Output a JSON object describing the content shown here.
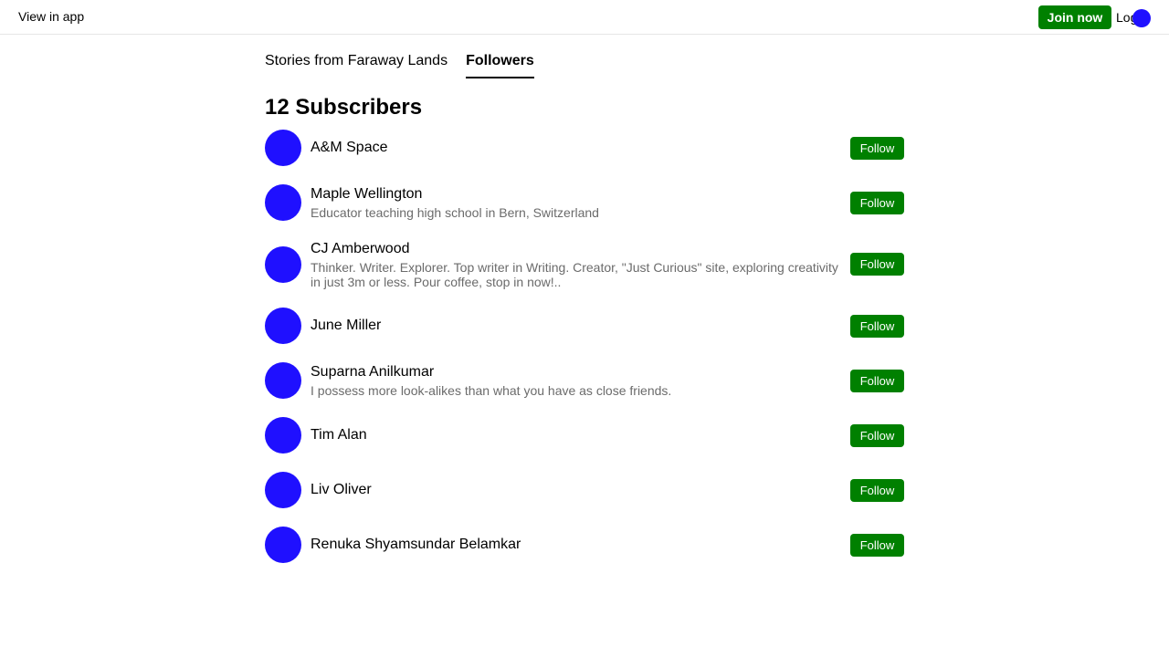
{
  "topbar": {
    "view_in_app": "View in app",
    "join_now": "Join now",
    "login": "Log"
  },
  "tabs": [
    {
      "label": "Stories from Faraway Lands",
      "active": false
    },
    {
      "label": "Followers",
      "active": true
    }
  ],
  "subscribers_title": "12 Subscribers",
  "follow_label": "Follow",
  "subscribers": [
    {
      "name": "A&M Space",
      "bio": ""
    },
    {
      "name": "Maple Wellington",
      "bio": "Educator teaching high school in Bern, Switzerland"
    },
    {
      "name": "CJ Amberwood",
      "bio": "Thinker. Writer. Explorer. Top writer in Writing. Creator, \"Just Curious\" site, exploring creativity in just 3m or less. Pour coffee, stop in now!.."
    },
    {
      "name": "June Miller",
      "bio": ""
    },
    {
      "name": "Suparna Anilkumar",
      "bio": "I possess more look-alikes than what you have as close friends."
    },
    {
      "name": "Tim Alan",
      "bio": ""
    },
    {
      "name": "Liv Oliver",
      "bio": ""
    },
    {
      "name": "Renuka Shyamsundar Belamkar",
      "bio": ""
    }
  ],
  "colors": {
    "accent_green": "#008000",
    "avatar_blue": "#1f10ff",
    "bio_gray": "#6b6b6b"
  }
}
